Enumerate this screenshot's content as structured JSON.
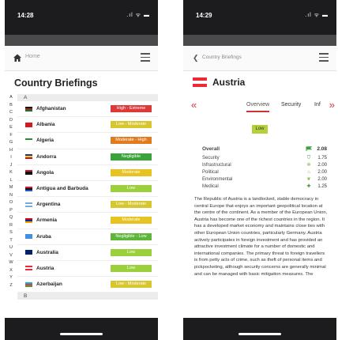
{
  "left": {
    "status": {
      "time": "14:28",
      "icons": ".ıl ᯤ ▬"
    },
    "appbar": {
      "home_label": "Home"
    },
    "title": "Country Briefings",
    "index": [
      "A",
      "B",
      "C",
      "D",
      "E",
      "F",
      "G",
      "H",
      "I",
      "J",
      "K",
      "L",
      "M",
      "N",
      "O",
      "P",
      "Q",
      "R",
      "S",
      "T",
      "U",
      "V",
      "W",
      "X",
      "Y",
      "Z"
    ],
    "sections": [
      {
        "header": "A",
        "rows": [
          {
            "name": "Afghanistan",
            "risk": "High - Extreme",
            "risk_color": "#dc3a3a",
            "flag_colors": [
              "#111111",
              "#b22222",
              "#0b7a30"
            ]
          },
          {
            "name": "Albania",
            "risk": "Low - Moderate",
            "risk_color": "#d8c630",
            "flag_colors": [
              "#d01c1f",
              "#d01c1f",
              "#d01c1f"
            ]
          },
          {
            "name": "Algeria",
            "risk": "Moderate - High",
            "risk_color": "#e07b1f",
            "flag_colors": [
              "#2a8a3a",
              "#ffffff",
              "#ffffff"
            ]
          },
          {
            "name": "Andorra",
            "risk": "Negligible",
            "risk_color": "#3aa43a",
            "flag_colors": [
              "#1d3a8a",
              "#f2c81a",
              "#c8102e"
            ]
          },
          {
            "name": "Angola",
            "risk": "Moderate",
            "risk_color": "#e6c320",
            "flag_colors": [
              "#cc1f2e",
              "#111111",
              "#111111"
            ]
          },
          {
            "name": "Antigua and Barbuda",
            "risk": "Low",
            "risk_color": "#9ccf3c",
            "flag_colors": [
              "#cc1f2e",
              "#111111",
              "#1f56c8"
            ]
          },
          {
            "name": "Argentina",
            "risk": "Low - Moderate",
            "risk_color": "#d8c630",
            "flag_colors": [
              "#74acdf",
              "#ffffff",
              "#74acdf"
            ]
          },
          {
            "name": "Armenia",
            "risk": "Moderate",
            "risk_color": "#e6c320",
            "flag_colors": [
              "#d90012",
              "#0033a0",
              "#f2a800"
            ]
          },
          {
            "name": "Aruba",
            "risk": "Negligible - Low",
            "risk_color": "#5db53a",
            "flag_colors": [
              "#418fde",
              "#418fde",
              "#418fde"
            ]
          },
          {
            "name": "Australia",
            "risk": "Low",
            "risk_color": "#9ccf3c",
            "flag_colors": [
              "#012169",
              "#012169",
              "#012169"
            ]
          },
          {
            "name": "Austria",
            "risk": "Low",
            "risk_color": "#9ccf3c",
            "flag_colors": [
              "#ed2939",
              "#ffffff",
              "#ed2939"
            ]
          },
          {
            "name": "Azerbaijan",
            "risk": "Low - Moderate",
            "risk_color": "#d8c630",
            "flag_colors": [
              "#00b5e2",
              "#ef3340",
              "#509e2f"
            ]
          }
        ]
      },
      {
        "header": "B",
        "rows": []
      }
    ]
  },
  "right": {
    "status": {
      "time": "14:29",
      "icons": ".ıl ᯤ ▬"
    },
    "appbar": {
      "back_label": "Country Briefings"
    },
    "title": "Austria",
    "flag_colors": [
      "#ed2939",
      "#ffffff",
      "#ed2939"
    ],
    "tabs": {
      "prev": "«",
      "overview": "Overview",
      "security": "Security",
      "inf": "Inf",
      "next": "»"
    },
    "risk_badge": {
      "label": "Low",
      "color": "#b3d23a"
    },
    "scores": {
      "overall": {
        "label": "Overall",
        "value": "2.08",
        "icon": "flag-icon",
        "icon_color": "#3aa43a"
      },
      "rows": [
        {
          "label": "Security",
          "value": "1.75",
          "icon": "shield-icon",
          "icon_color": "#3a8a3a",
          "glyph": "⛉"
        },
        {
          "label": "Infrastructural",
          "value": "2.00",
          "icon": "gear-icon",
          "icon_color": "#7cae2a",
          "glyph": "✲"
        },
        {
          "label": "Political",
          "value": "2.00",
          "icon": "building-icon",
          "icon_color": "#7cae2a",
          "glyph": "⌂"
        },
        {
          "label": "Environmental",
          "value": "2.00",
          "icon": "leaf-icon",
          "icon_color": "#7cae2a",
          "glyph": "❦"
        },
        {
          "label": "Medical",
          "value": "1.25",
          "icon": "medkit-icon",
          "icon_color": "#3a8a3a",
          "glyph": "✚"
        }
      ]
    },
    "description": "The Republic of Austria is a landlocked, stable democracy in central Europe that enjoys an important geopolitical location at the centre of the continent. As a member of the European Union, Austria has become one of the richest countries in the region. It has a developed market economy and maintains close ties with other European Union countries, particularly Germany. Austria actively participates in foreign investment and has provided an attractive investment climate for a number of domestic and international companies. The primary threat to foreign travellers is from petty acts of crime, such as theft of personal items and pickpocketing, although security concerns are generally minimal and can be managed with basic mitigation measures. The"
  }
}
